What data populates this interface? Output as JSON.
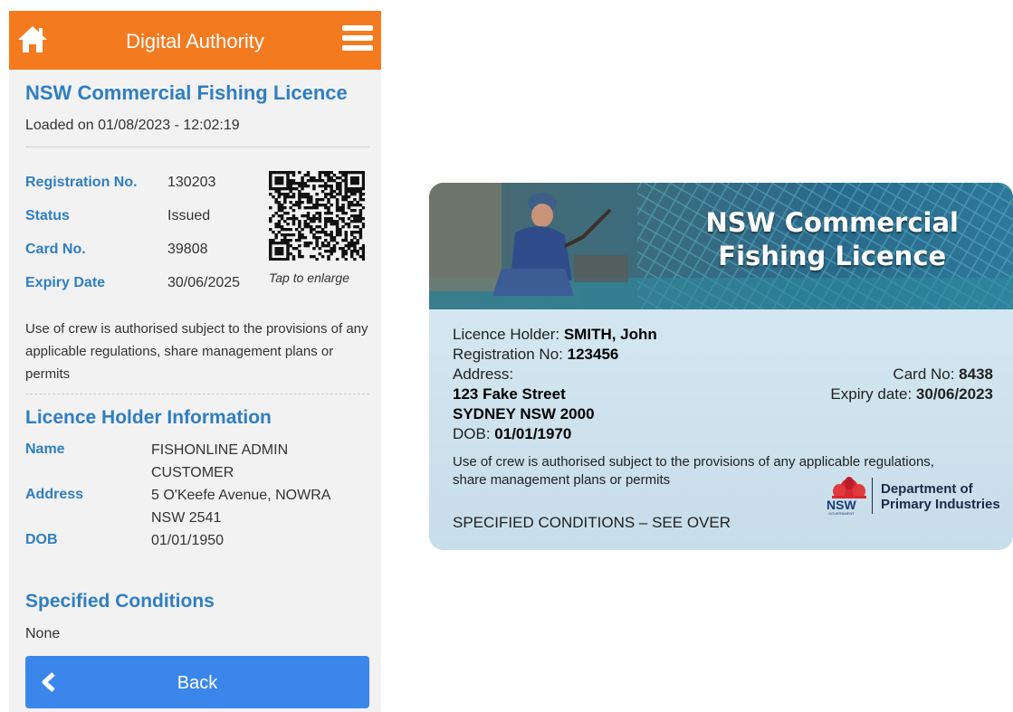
{
  "app": {
    "title": "Digital Authority",
    "licence_title": "NSW Commercial Fishing Licence",
    "loaded_on": "Loaded on 01/08/2023 - 12:02:19",
    "fields": [
      {
        "label": "Registration No.",
        "value": "130203"
      },
      {
        "label": "Status",
        "value": "Issued"
      },
      {
        "label": "Card No.",
        "value": "39808"
      },
      {
        "label": "Expiry Date",
        "value": "30/06/2025"
      }
    ],
    "qr_hint": "Tap to enlarge",
    "crew_note": "Use of crew is authorised subject to the provisions of any applicable regulations, share management plans or permits",
    "holder_heading": "Licence Holder Information",
    "holder": {
      "name_label": "Name",
      "name_line1": "FISHONLINE ADMIN",
      "name_line2": "CUSTOMER",
      "address_label": "Address",
      "address_line1": "5 O'Keefe Avenue, NOWRA",
      "address_line2": "NSW 2541",
      "dob_label": "DOB",
      "dob": "01/01/1950"
    },
    "conditions_heading": "Specified Conditions",
    "conditions_value": "None",
    "back_label": "Back",
    "colors": {
      "topbar": "#f47a20",
      "accent": "#2f7ec2",
      "back_button": "#3b86ea"
    },
    "icons": {
      "home": "home-icon",
      "menu": "hamburger-menu-icon",
      "back": "chevron-left-icon"
    }
  },
  "card": {
    "title_line1": "NSW Commercial",
    "title_line2": "Fishing Licence",
    "holder_label": "Licence Holder: ",
    "holder_value": "SMITH, John",
    "reg_label": "Registration No: ",
    "reg_value": "123456",
    "address_label": "Address:",
    "address_line1": "123 Fake Street",
    "address_line2": "SYDNEY  NSW  2000",
    "dob_label": "DOB:  ",
    "dob_value": "01/01/1970",
    "card_no_label": "Card No: ",
    "card_no_value": "8438",
    "expiry_label": "Expiry date: ",
    "expiry_value": "30/06/2023",
    "crew_note": "Use of crew is authorised subject to the provisions of any applicable regulations, share management plans or permits",
    "conditions": "SPECIFIED CONDITIONS – SEE OVER",
    "dept_line1": "Department of",
    "dept_line2": "Primary Industries",
    "nsw_logo_text": "NSW",
    "nsw_logo_sub": "GOVERNMENT"
  }
}
